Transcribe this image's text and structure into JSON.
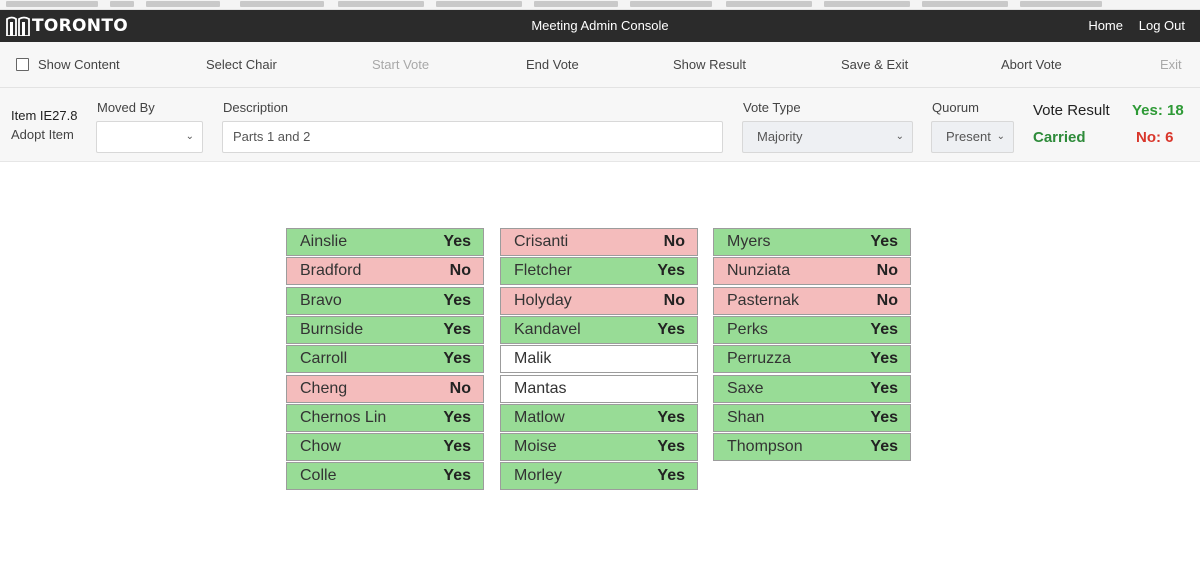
{
  "header": {
    "logo_text": "TORONTO",
    "app_title": "Meeting Admin Console",
    "nav": {
      "home": "Home",
      "logout": "Log Out"
    }
  },
  "toolbar": {
    "show_content": "Show Content",
    "select_chair": "Select Chair",
    "start_vote": "Start Vote",
    "end_vote": "End Vote",
    "show_result": "Show Result",
    "save_exit": "Save & Exit",
    "abort_vote": "Abort Vote",
    "exit": "Exit",
    "show_content_checked": false
  },
  "item": {
    "id": "Item IE27.8",
    "action": "Adopt Item",
    "moved_by_label": "Moved By",
    "moved_by_value": "",
    "description_label": "Description",
    "description_value": "Parts 1 and 2",
    "vote_type_label": "Vote Type",
    "vote_type_value": "Majority",
    "quorum_label": "Quorum",
    "quorum_value": "Present"
  },
  "result": {
    "label": "Vote Result",
    "status": "Carried",
    "yes": "Yes: 18",
    "no": "No: 6"
  },
  "colors": {
    "yes_bg": "#98dc96",
    "no_bg": "#f4bcbc",
    "carried": "#2e8b3a",
    "no_count": "#d9362b"
  },
  "columns": [
    [
      {
        "name": "Ainslie",
        "vote": "Yes"
      },
      {
        "name": "Bradford",
        "vote": "No"
      },
      {
        "name": "Bravo",
        "vote": "Yes"
      },
      {
        "name": "Burnside",
        "vote": "Yes"
      },
      {
        "name": "Carroll",
        "vote": "Yes"
      },
      {
        "name": "Cheng",
        "vote": "No"
      },
      {
        "name": "Chernos Lin",
        "vote": "Yes"
      },
      {
        "name": "Chow",
        "vote": "Yes"
      },
      {
        "name": "Colle",
        "vote": "Yes"
      }
    ],
    [
      {
        "name": "Crisanti",
        "vote": "No"
      },
      {
        "name": "Fletcher",
        "vote": "Yes"
      },
      {
        "name": "Holyday",
        "vote": "No"
      },
      {
        "name": "Kandavel",
        "vote": "Yes"
      },
      {
        "name": "Malik",
        "vote": ""
      },
      {
        "name": "Mantas",
        "vote": ""
      },
      {
        "name": "Matlow",
        "vote": "Yes"
      },
      {
        "name": "Moise",
        "vote": "Yes"
      },
      {
        "name": "Morley",
        "vote": "Yes"
      }
    ],
    [
      {
        "name": "Myers",
        "vote": "Yes"
      },
      {
        "name": "Nunziata",
        "vote": "No"
      },
      {
        "name": "Pasternak",
        "vote": "No"
      },
      {
        "name": "Perks",
        "vote": "Yes"
      },
      {
        "name": "Perruzza",
        "vote": "Yes"
      },
      {
        "name": "Saxe",
        "vote": "Yes"
      },
      {
        "name": "Shan",
        "vote": "Yes"
      },
      {
        "name": "Thompson",
        "vote": "Yes"
      }
    ]
  ]
}
